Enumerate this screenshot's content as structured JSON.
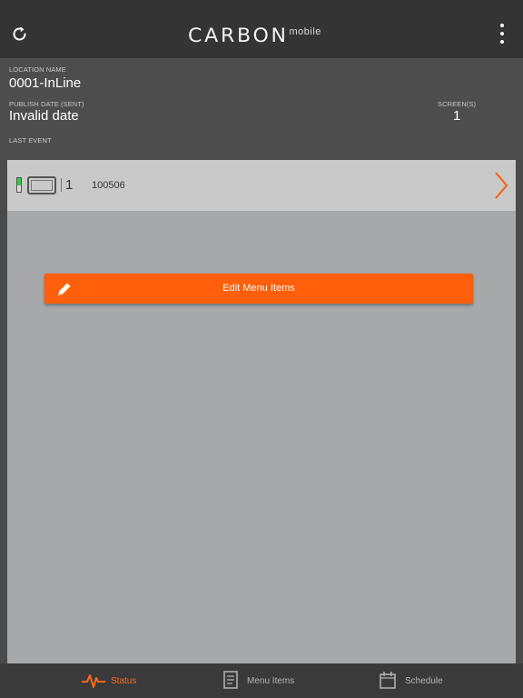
{
  "header": {
    "logo_main": "CARBON",
    "logo_sub": "mobile",
    "refresh_icon": "refresh-icon",
    "menu_icon": "more-vertical-icon"
  },
  "info": {
    "location_label": "LOCATION NAME",
    "location_value": "0001-InLine",
    "publish_label": "PUBLISH DATE (SENT)",
    "publish_value": "Invalid date",
    "screens_label": "SCREEN(S)",
    "screens_value": "1",
    "last_event_label": "LAST EVENT"
  },
  "screen_row": {
    "number": "1",
    "id": "100506",
    "status_color": "#2ecc40"
  },
  "edit_button": {
    "label": "Edit Menu Items",
    "icon": "pencil-icon",
    "color": "#ff5e0a"
  },
  "tabs": [
    {
      "label": "Status",
      "icon": "pulse-icon",
      "active": true
    },
    {
      "label": "Menu Items",
      "icon": "document-icon",
      "active": false
    },
    {
      "label": "Schedule",
      "icon": "calendar-icon",
      "active": false
    }
  ],
  "colors": {
    "accent": "#ff5e0a",
    "header_bg": "#343434",
    "tab_active": "#ff6a1a"
  }
}
